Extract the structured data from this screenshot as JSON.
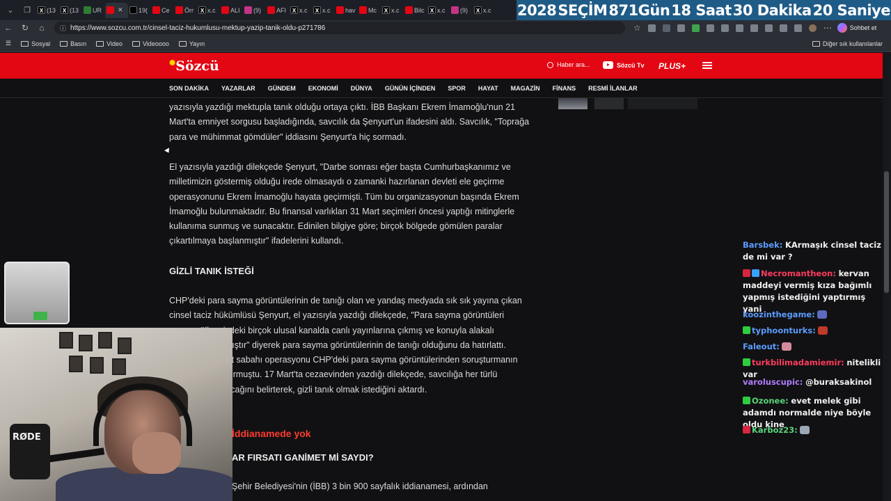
{
  "browser": {
    "tabs": [
      {
        "label": "(13",
        "icon": "x-icon",
        "color": "#000000"
      },
      {
        "label": "(13",
        "icon": "x-icon",
        "color": "#000000"
      },
      {
        "label": "UR",
        "icon": "ur-icon",
        "color": "#2e7d32"
      },
      {
        "label": "",
        "icon": "sozcu-icon",
        "color": "#e30613",
        "active": true
      },
      {
        "label": "19(",
        "icon": "tiktok-icon",
        "color": "#000000"
      },
      {
        "label": "Ce",
        "icon": "youtube-icon",
        "color": "#e30613"
      },
      {
        "label": "Örr",
        "icon": "news-icon",
        "color": "#e30613"
      },
      {
        "label": "x.c",
        "icon": "x-icon",
        "color": "#000000"
      },
      {
        "label": "ALI",
        "icon": "youtube-icon",
        "color": "#e30613"
      },
      {
        "label": "(9)",
        "icon": "instagram-icon",
        "color": "#c13584"
      },
      {
        "label": "AFI",
        "icon": "youtube-icon",
        "color": "#e30613"
      },
      {
        "label": "x.c",
        "icon": "x-icon",
        "color": "#000000"
      },
      {
        "label": "x.c",
        "icon": "x-icon",
        "color": "#000000"
      },
      {
        "label": "hav",
        "icon": "youtube-icon",
        "color": "#e30613"
      },
      {
        "label": "Mc",
        "icon": "youtube-icon",
        "color": "#e30613"
      },
      {
        "label": "x.c",
        "icon": "x-icon",
        "color": "#000000"
      },
      {
        "label": "Bilc",
        "icon": "youtube-icon",
        "color": "#e30613"
      },
      {
        "label": "x.c",
        "icon": "x-icon",
        "color": "#000000"
      },
      {
        "label": "(9)",
        "icon": "instagram-icon",
        "color": "#c13584"
      },
      {
        "label": "x.c",
        "icon": "x-icon",
        "color": "#000000"
      }
    ],
    "url": "https://www.sozcu.com.tr/cinsel-taciz-hukumlusu-mektup-yazip-tanik-oldu-p271786",
    "countdown": [
      "2028",
      "SEÇİM",
      "871Gün",
      "18 Saat",
      "30 Dakika",
      "20 Saniye"
    ],
    "chat_button": "Sohbet et",
    "bookmarks": [
      "Sosyal",
      "Basın",
      "Video",
      "Videoooo",
      "Yayın"
    ],
    "bookmarks_right": "Diğer sık kullanılanlar"
  },
  "site": {
    "logo": "Sözcü",
    "search_label": "Haber ara...",
    "tv_label": "Sözcü Tv",
    "plus_label": "PLUS+",
    "nav": [
      "SON DAKİKA",
      "YAZARLAR",
      "GÜNDEM",
      "EKONOMİ",
      "DÜNYA",
      "GÜNÜN İÇİNDEN",
      "SPOR",
      "HAYAT",
      "MAGAZİN",
      "FİNANS",
      "RESMİ İLANLAR"
    ]
  },
  "article": {
    "p1": "yazısıyla yazdığı mektupla tanık olduğu ortaya çıktı. İBB Başkanı Ekrem İmamoğlu'nun 21 Mart'ta emniyet sorgusu başladığında, savcılık da Şenyurt'un ifadesini aldı. Savcılık, \"Toprağa para ve mühimmat gömdüler\" iddiasını Şenyurt'a hiç sormadı.",
    "p2": "El yazısıyla yazdığı dilekçede Şenyurt, \"Darbe sonrası eğer başta Cumhurbaşkanımız ve milletimizin göstermiş olduğu irede olmasaydı o zamanki hazırlanan devleti ele geçirme operasyonunu Ekrem İmamoğlu hayata geçirmişti. Tüm bu organizasyonun başında Ekrem İmamoğlu bulunmaktadır. Bu finansal varlıkları 31 Mart seçimleri öncesi yaptığı mitinglerle kullanıma sunmuş ve sunacaktır. Edinilen bilgiye göre; birçok bölgede gömülen paralar çıkartılmaya başlanmıştır\" ifadelerini kullandı.",
    "h1": "GİZLİ TANIK İSTEĞİ",
    "p3": "CHP'deki para sayma görüntülerinin de tanığı olan ve yandaş medyada sık sık yayına çıkan cinsel taciz hükümlüsü Şenyurt, el yazısıyla yazdığı dilekçede, \"Para sayma görüntüleri sonrası ülkemizdeki birçok ulusal kanalda canlı yayınlarına çıkmış ve konuyla alakalı röportajım alınmıştır\" diyerek para sayma görüntülerinin de tanığı olduğunu da hatırlattı. Savcılık, 19 Mart sabahı operasyonu CHP'deki para sayma görüntülerinden soruşturmanın başlattığını duyurmuştu. 17 Mart'ta cezaevinden yazdığı dilekçede, savcılığa her türlü destekte bulunacağını belirterek, gizli tanık olmak istediğini aktardı.",
    "h2": "İddianamede yok",
    "h3": "AR FIRSATI GANİMET Mİ SAYDI?",
    "p4": "Şehir Belediyesi'nin (İBB) 3 bin 900 sayfalık iddianamesi, ardından"
  },
  "chat": [
    {
      "user": "Barsbek:",
      "color": "#5b9cff",
      "text": "KArmaşık cinsel taciz de mi var ?",
      "badges": []
    },
    {
      "user": "Necromantheon:",
      "color": "#ff3b5c",
      "text": "kervan maddeyi vermiş kıza bağımlı yapmış istediğini yaptırmış yani",
      "badges": [
        "#d7263d",
        "#3aa0ff"
      ]
    },
    {
      "user": "koozinthegame:",
      "color": "#5b9cff",
      "text": "",
      "badges": [],
      "emote": "#5c6bc0"
    },
    {
      "user": "typhoonturks:",
      "color": "#5b9cff",
      "text": "",
      "badges": [
        "#2ecc40"
      ],
      "emote": "#c0392b"
    },
    {
      "user": "Faleout:",
      "color": "#5b9cff",
      "text": "",
      "badges": [],
      "emote": "#d48a9b"
    },
    {
      "user": "turkbilimadamiemir:",
      "color": "#ff3b5c",
      "text": "nitelikli var",
      "badges": [
        "#2ecc40"
      ]
    },
    {
      "user": "varoluscupic:",
      "color": "#b07cff",
      "text": "@buraksakinol",
      "badges": []
    },
    {
      "user": "Ozonee:",
      "color": "#5bd37a",
      "text": "evet melek gibi adamdı normalde niye böyle oldu kine",
      "badges": [
        "#2ecc40"
      ]
    },
    {
      "user": "Karboz23:",
      "color": "#5bd37a",
      "text": "",
      "badges": [
        "#d7263d"
      ],
      "emote": "#9aa7b5"
    }
  ],
  "webcam": {
    "mic_label": "RØDE"
  }
}
